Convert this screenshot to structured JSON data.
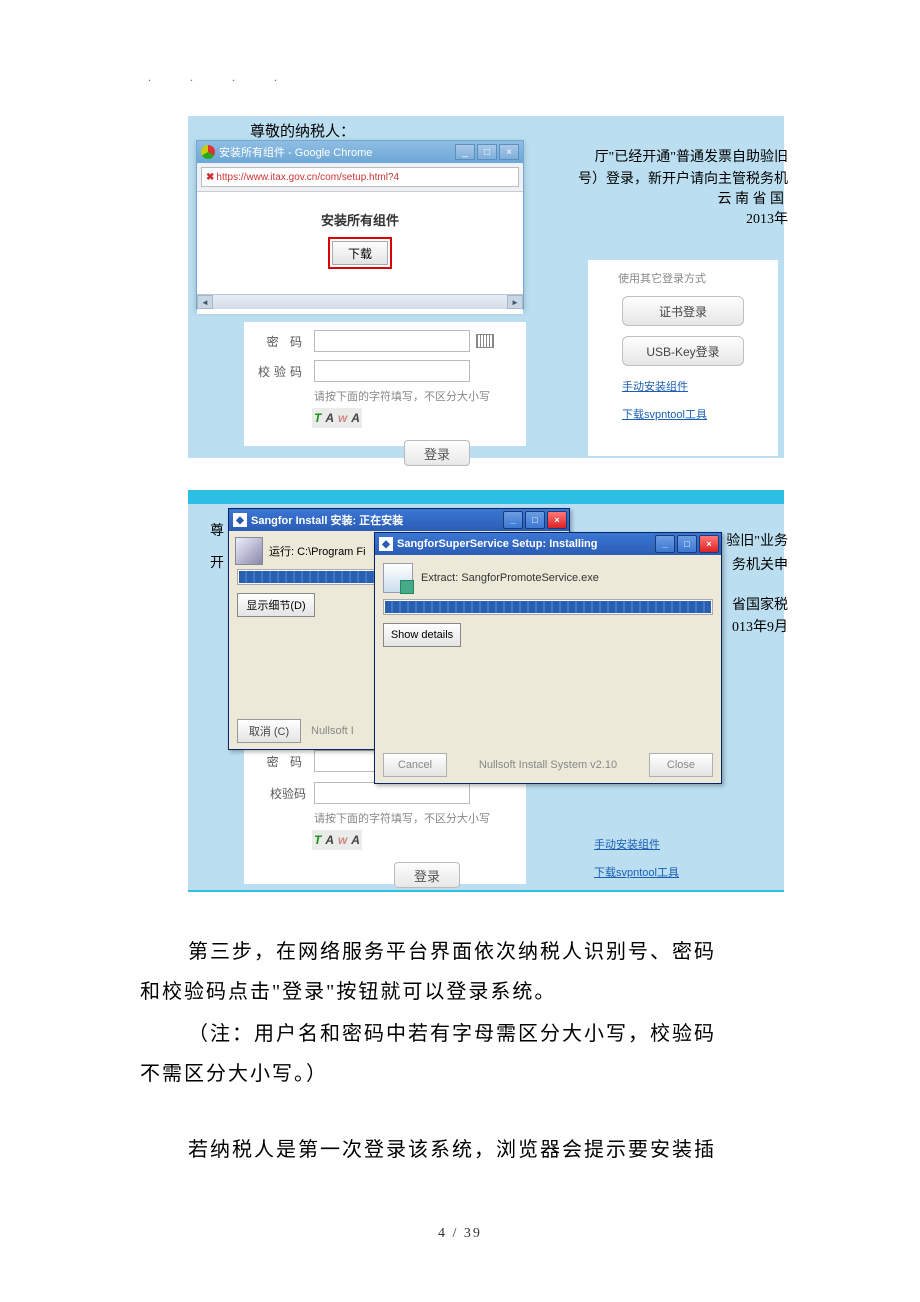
{
  "dots": ". . . .",
  "shot1": {
    "line_greeting": "尊敬的纳税人：",
    "right1": "厅\"已经开通\"普通发票自助验旧",
    "right2": "号）登录，新开户请向主管税务机",
    "right3": "云 南 省 国",
    "right4": "2013年",
    "chrome": {
      "title": "安装所有组件 - Google Chrome",
      "url": "https://www.itax.gov.cn/com/setup.html?4",
      "heading": "安装所有组件",
      "download": "下载"
    },
    "form": {
      "password_label": "密 码",
      "captcha_label": "校验码",
      "hint": "请按下面的字符填写，不区分大小写",
      "captcha_chars": [
        "T",
        "A",
        "w",
        "A"
      ],
      "login": "登录"
    },
    "right_panel": {
      "title": "使用其它登录方式",
      "cert": "证书登录",
      "usb": "USB-Key登录",
      "link1": "手动安装组件",
      "link2": "下载svpntool工具"
    }
  },
  "shot2": {
    "zun": "尊",
    "kai": "开",
    "r1": "验旧\"业务",
    "r2": "务机关申",
    "r3": "省国家税",
    "r4": "013年9月",
    "xp1": {
      "title": "Sangfor Install 安装: 正在安装",
      "runtext": "运行: C:\\Program Fi",
      "details": "显示细节(D)",
      "cancel": "取消 (C)",
      "system": "Nullsoft I"
    },
    "xp2": {
      "title": "SangforSuperService Setup: Installing",
      "extract": "Extract: SangforPromoteService.exe",
      "details": "Show details",
      "cancel": "Cancel",
      "system": "Nullsoft Install System v2.10",
      "close": "Close"
    },
    "form": {
      "password_label": "密 码",
      "captcha_label": "校验码",
      "hint": "请按下面的字符填写，不区分大小写",
      "captcha_chars": [
        "T",
        "A",
        "w",
        "A"
      ],
      "login": "登录"
    },
    "right_panel": {
      "link1": "手动安装组件",
      "link2": "下载svpntool工具"
    }
  },
  "paragraphs": {
    "p1a": "第三步，在网络服务平台界面依次纳税人识别号、密码",
    "p1b": "和校验码点击\"登录\"按钮就可以登录系统。",
    "p2a": "（注：用户名和密码中若有字母需区分大小写，校验码",
    "p2b": "不需区分大小写。）",
    "p3a": "若纳税人是第一次登录该系统，浏览器会提示要安装插"
  },
  "page_number": "4 / 39"
}
